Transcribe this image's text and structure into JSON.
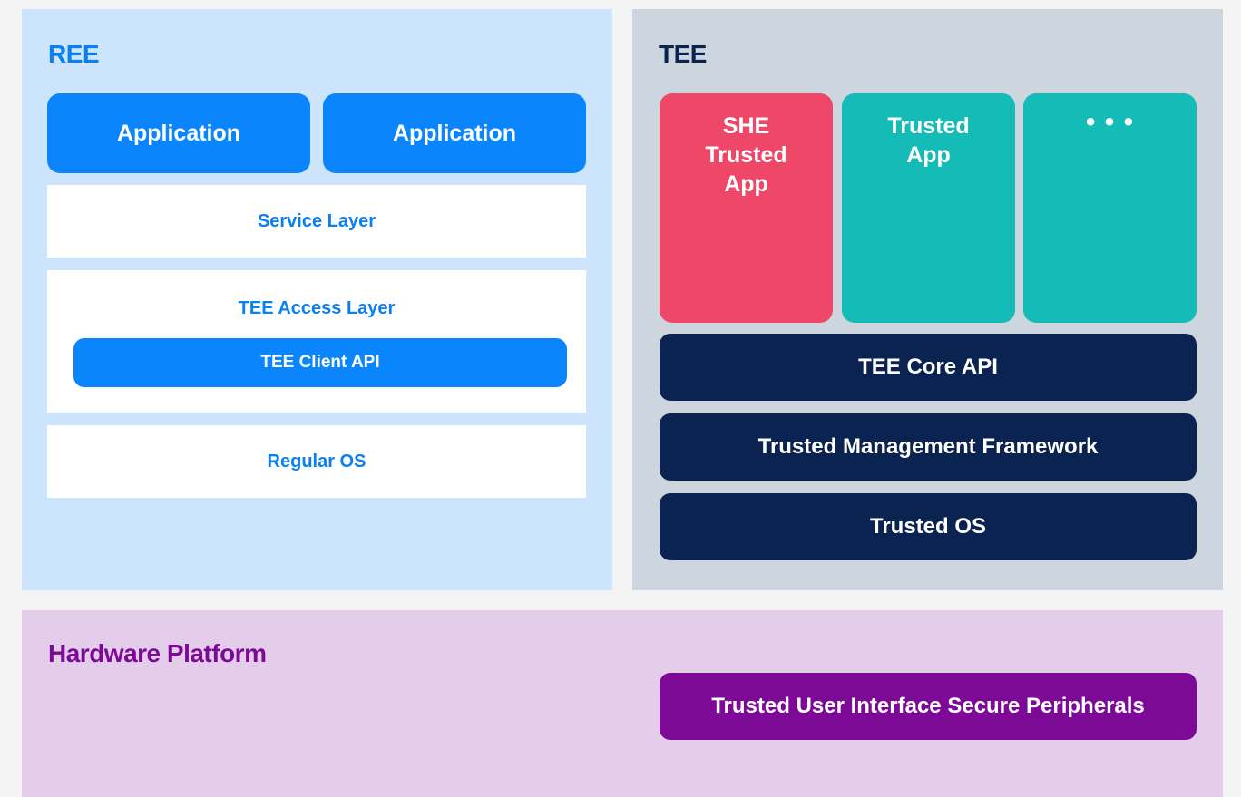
{
  "ree": {
    "title": "REE",
    "applications": [
      "Application",
      "Application"
    ],
    "service_layer": "Service Layer",
    "access_layer": "TEE Access Layer",
    "client_api": "TEE Client API",
    "regular_os": "Regular OS"
  },
  "tee": {
    "title": "TEE",
    "trusted_apps": [
      "SHE\nTrusted\nApp",
      "Trusted\nApp",
      "• • •"
    ],
    "core_api": "TEE Core API",
    "management_framework": "Trusted Management Framework",
    "trusted_os": "Trusted OS"
  },
  "hardware": {
    "title": "Hardware Platform",
    "tui": "Trusted User Interface Secure Peripherals"
  },
  "colors": {
    "ree_bg": "#cce5fc",
    "tee_bg": "#cdd5df",
    "hw_bg": "#e4cdea",
    "blue": "#0a85fc",
    "navy": "#0b2350",
    "red": "#ef4768",
    "teal": "#15bbb6",
    "purple": "#7c0a97"
  }
}
